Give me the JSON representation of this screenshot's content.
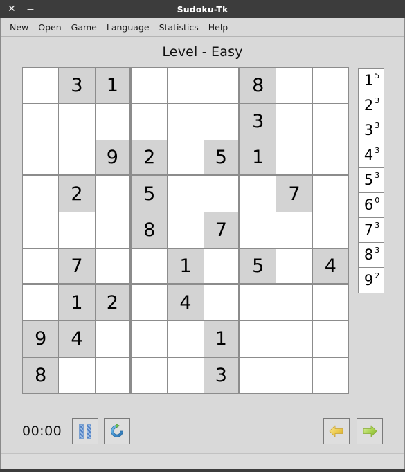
{
  "window": {
    "title": "Sudoku-Tk",
    "close_label": "✕",
    "minimize_label": "‒"
  },
  "menubar": {
    "items": [
      {
        "label": "New",
        "name": "menu-new"
      },
      {
        "label": "Open",
        "name": "menu-open"
      },
      {
        "label": "Game",
        "name": "menu-game"
      },
      {
        "label": "Language",
        "name": "menu-language"
      },
      {
        "label": "Statistics",
        "name": "menu-statistics"
      },
      {
        "label": "Help",
        "name": "menu-help"
      }
    ]
  },
  "header": {
    "level_text": "Level -  Easy",
    "level_label": "Level -",
    "level_value": "Easy"
  },
  "board": {
    "size": 9,
    "rows": [
      [
        "",
        "3",
        "1",
        "",
        "",
        "",
        "8",
        "",
        ""
      ],
      [
        "",
        "",
        "",
        "",
        "",
        "",
        "3",
        "",
        ""
      ],
      [
        "",
        "",
        "9",
        "2",
        "",
        "5",
        "1",
        "",
        ""
      ],
      [
        "",
        "2",
        "",
        "5",
        "",
        "",
        "",
        "7",
        ""
      ],
      [
        "",
        "",
        "",
        "8",
        "",
        "7",
        "",
        "",
        ""
      ],
      [
        "",
        "7",
        "",
        "",
        "1",
        "",
        "5",
        "",
        "4"
      ],
      [
        "",
        "1",
        "2",
        "",
        "4",
        "",
        "",
        "",
        ""
      ],
      [
        "9",
        "4",
        "",
        "",
        "",
        "1",
        "",
        "",
        ""
      ],
      [
        "8",
        "",
        "",
        "",
        "",
        "3",
        "",
        "",
        ""
      ]
    ],
    "colors": {
      "given_background": "#d3d3d3",
      "empty_background": "#ffffff",
      "grid_line": "#8c8c8c"
    }
  },
  "counter_panel": {
    "entries": [
      {
        "digit": "1",
        "count": "5"
      },
      {
        "digit": "2",
        "count": "3"
      },
      {
        "digit": "3",
        "count": "3"
      },
      {
        "digit": "4",
        "count": "3"
      },
      {
        "digit": "5",
        "count": "3"
      },
      {
        "digit": "6",
        "count": "0"
      },
      {
        "digit": "7",
        "count": "3"
      },
      {
        "digit": "8",
        "count": "3"
      },
      {
        "digit": "9",
        "count": "2"
      }
    ]
  },
  "toolbar": {
    "timer": "00:00",
    "pause_name": "pause-button",
    "restart_name": "restart-button",
    "undo_name": "undo-button",
    "redo_name": "redo-button",
    "colors": {
      "pause_icon": "#4f7fc4",
      "refresh_icon": "#3f8fd0",
      "undo_arrow": "#e8c84a",
      "redo_arrow": "#9ed14a"
    }
  },
  "theme": {
    "titlebar_background": "#3c3c3c",
    "client_background": "#d9d9d9",
    "text": "#111111"
  }
}
